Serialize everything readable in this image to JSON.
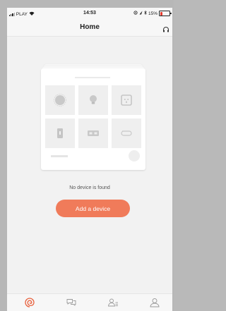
{
  "status_bar": {
    "carrier": "PLAY",
    "time": "14:53",
    "battery": "15%",
    "battery_color": "#e43b2e"
  },
  "header": {
    "title": "Home",
    "right_icon": "headset-icon"
  },
  "empty_state": {
    "message": "No device is found",
    "tiles": [
      "robot-vacuum-icon",
      "bulb-icon",
      "smart-plug-icon",
      "door-sensor-icon",
      "switch-panel-icon",
      "loop-arrows-icon"
    ]
  },
  "actions": {
    "add_device_label": "Add a device",
    "accent_color": "#f07b5a"
  },
  "tabbar": {
    "tabs": [
      {
        "icon": "home-swirl-icon",
        "active": true
      },
      {
        "icon": "chat-icon",
        "active": false
      },
      {
        "icon": "profile-list-icon",
        "active": false
      },
      {
        "icon": "user-icon",
        "active": false
      }
    ]
  }
}
